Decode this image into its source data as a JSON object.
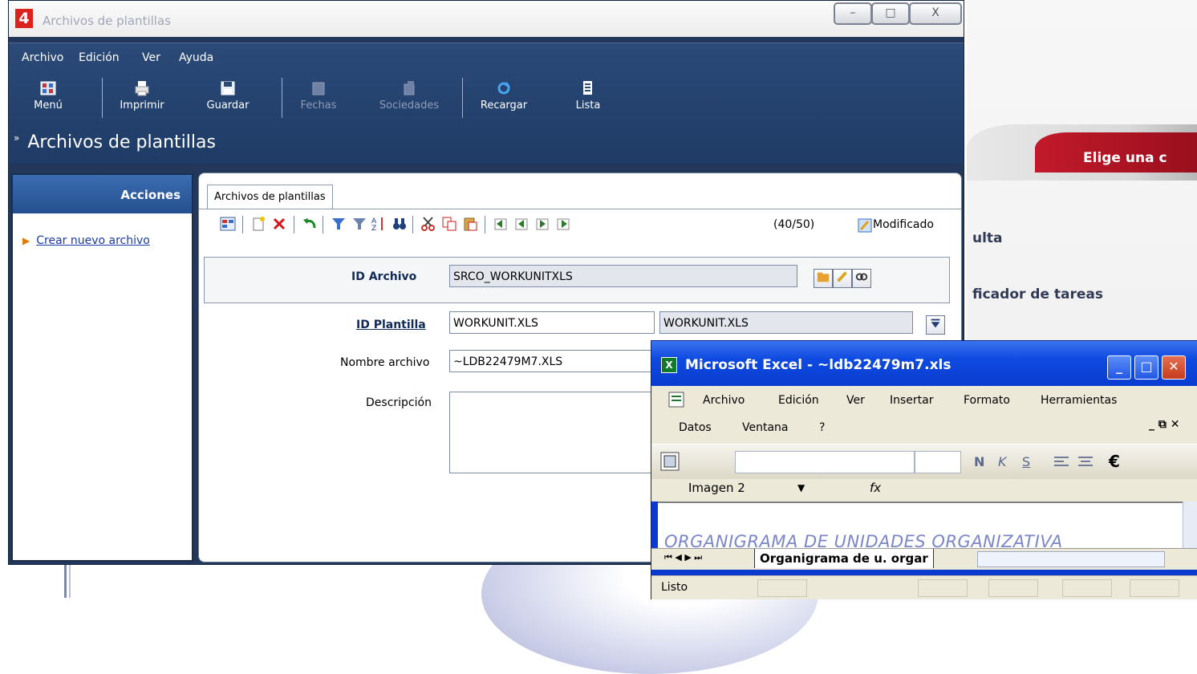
{
  "main_window": {
    "title": "Archivos de plantillas",
    "logo": "4",
    "controls": {
      "minimize": "–",
      "maximize": "□",
      "close": "X"
    }
  },
  "menu": [
    "Archivo",
    "Edición",
    "Ver",
    "Ayuda"
  ],
  "toolbar": {
    "menu": "Menú",
    "print": "Imprimir",
    "save": "Guardar",
    "dates": "Fechas",
    "companies": "Sociedades",
    "reload": "Recargar",
    "list": "Lista"
  },
  "section_title": "Archivos de plantillas",
  "sidebar": {
    "header": "Acciones",
    "items": [
      {
        "label": "Crear nuevo archivo"
      }
    ]
  },
  "panel": {
    "tab": "Archivos de plantillas",
    "counter": "(40/50)",
    "status": "Modificado"
  },
  "form": {
    "id_archivo": {
      "label": "ID Archivo",
      "value": "SRCO_WORKUNITXLS"
    },
    "id_plantilla": {
      "label": "ID Plantilla",
      "value": "WORKUNIT.XLS",
      "description": "WORKUNIT.XLS"
    },
    "nombre_archivo": {
      "label": "Nombre archivo",
      "value": "~LDB22479M7.XLS"
    },
    "descripcion": {
      "label": "Descripción",
      "value": ""
    }
  },
  "background": {
    "banner": "Elige una c",
    "item1": "ulta",
    "item2": "ficador de tareas"
  },
  "excel": {
    "title": "Microsoft Excel - ~ldb22479m7.xls",
    "menu_row1": [
      "Archivo",
      "Edición",
      "Ver",
      "Insertar",
      "Formato",
      "Herramientas"
    ],
    "menu_row2": [
      "Datos",
      "Ventana",
      "?"
    ],
    "name_box": "Imagen 2",
    "fx": "fx",
    "sheet_heading": "ORGANIGRAMA DE UNIDADES ORGANIZATIVA",
    "sheet_tab": "Organigrama de u. orgar",
    "status": "Listo",
    "format_buttons": [
      "N",
      "K",
      "S"
    ],
    "currency": "€"
  }
}
